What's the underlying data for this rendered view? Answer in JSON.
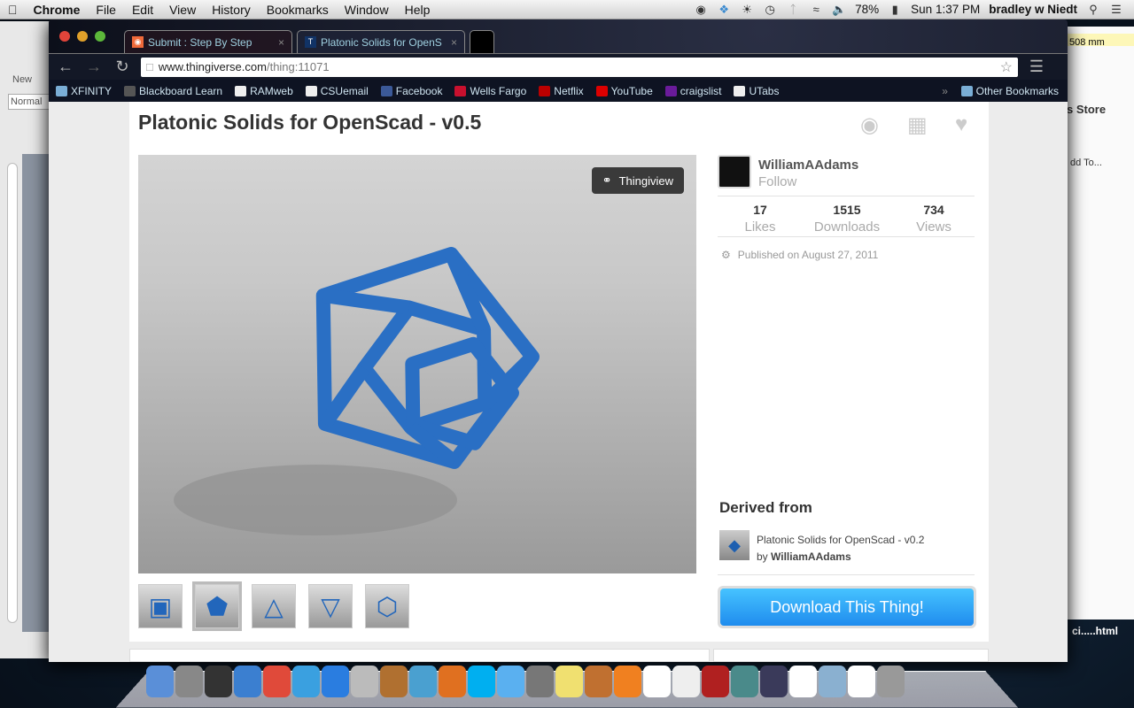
{
  "menubar": {
    "app": "Chrome",
    "items": [
      "File",
      "Edit",
      "View",
      "History",
      "Bookmarks",
      "Window",
      "Help"
    ],
    "battery": "78%",
    "clock": "Sun 1:37 PM",
    "user": "bradley w Niedt"
  },
  "background_windows": {
    "word_new": "New",
    "word_style": "Normal",
    "sticky_text": "508 mm",
    "store_button": "s Store",
    "add_to": "dd To...",
    "file_label": "ci.....html"
  },
  "tabs": [
    {
      "label": "Submit : Step By Step",
      "active": false
    },
    {
      "label": "Platonic Solids for OpenS",
      "active": true
    }
  ],
  "address": {
    "host": "www.thingiverse.com",
    "path": "/thing:11071"
  },
  "bookmarks": [
    {
      "label": "XFINITY",
      "color": "#7aaed6"
    },
    {
      "label": "Blackboard Learn",
      "color": "#555"
    },
    {
      "label": "RAMweb",
      "color": "#eee"
    },
    {
      "label": "CSUemail",
      "color": "#eee"
    },
    {
      "label": "Facebook",
      "color": "#3b5998"
    },
    {
      "label": "Wells Fargo",
      "color": "#c8102e"
    },
    {
      "label": "Netflix",
      "color": "#b00"
    },
    {
      "label": "YouTube",
      "color": "#d00"
    },
    {
      "label": "craigslist",
      "color": "#6a1b9a"
    },
    {
      "label": "UTabs",
      "color": "#eee"
    }
  ],
  "other_bookmarks": "Other Bookmarks",
  "thing": {
    "title": "Platonic Solids for OpenScad - v0.5",
    "thingview": "Thingiview",
    "author": "WilliamAAdams",
    "follow": "Follow",
    "stats": [
      {
        "value": "17",
        "label": "Likes"
      },
      {
        "value": "1515",
        "label": "Downloads"
      },
      {
        "value": "734",
        "label": "Views"
      }
    ],
    "published": "Published on August 27, 2011",
    "derived_heading": "Derived from",
    "derived_title": "Platonic Solids for OpenScad - v0.2",
    "derived_by": "by",
    "derived_author": "WilliamAAdams",
    "download": "Download This Thing!",
    "thumbnails": [
      "cube",
      "dodecahedron",
      "tetrahedron",
      "octahedron",
      "icosahedron"
    ],
    "selected_thumbnail": 1,
    "model_color": "#2a6fc4"
  },
  "dock": [
    [
      "finder",
      "#5a8fd8"
    ],
    [
      "launchpad",
      "#888"
    ],
    [
      "dashboard",
      "#333"
    ],
    [
      "itunes",
      "#3b7fd0"
    ],
    [
      "chrome",
      "#e04a3a"
    ],
    [
      "safari",
      "#3aa0e0"
    ],
    [
      "app-store",
      "#2a7de0"
    ],
    [
      "script",
      "#bbb"
    ],
    [
      "xcode",
      "#b07030"
    ],
    [
      "word",
      "#4aa0d0"
    ],
    [
      "powerpoint",
      "#e07020"
    ],
    [
      "skype",
      "#00aff0"
    ],
    [
      "messages",
      "#5ab0f0"
    ],
    [
      "system-preferences",
      "#777"
    ],
    [
      "stickies",
      "#f0e070"
    ],
    [
      "iphoto",
      "#c07030"
    ],
    [
      "audacity",
      "#f08020"
    ],
    [
      "calendar",
      "#fff"
    ],
    [
      "reminders",
      "#eee"
    ],
    [
      "photo-booth",
      "#b02020"
    ],
    [
      "time-machine",
      "#4a8a8a"
    ],
    [
      "app",
      "#3a3a5a"
    ],
    [
      "solitaire",
      "#fff"
    ],
    [
      "documents",
      "#8ab0d0"
    ],
    [
      "file",
      "#fff"
    ],
    [
      "trash",
      "#999"
    ]
  ]
}
